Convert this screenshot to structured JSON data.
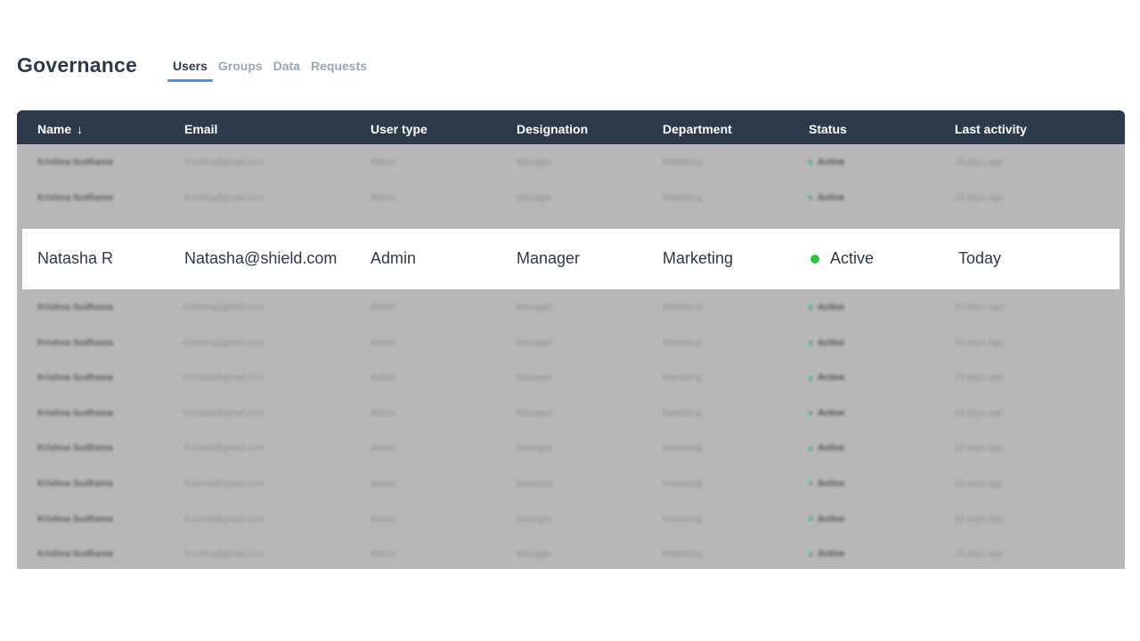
{
  "page": {
    "title": "Governance",
    "tabs": [
      {
        "label": "Users",
        "active": true
      },
      {
        "label": "Groups",
        "active": false
      },
      {
        "label": "Data",
        "active": false
      },
      {
        "label": "Requests",
        "active": false
      }
    ]
  },
  "table": {
    "columns": [
      "Name",
      "Email",
      "User type",
      "Designation",
      "Department",
      "Status",
      "Last activity"
    ],
    "sort_icon": "arrow-down-icon",
    "blurred_row": {
      "name": "Krishna Sudhama",
      "email": "Krishna@gmail.com",
      "user_type": "Admin",
      "designation": "Manager",
      "department": "Marketing",
      "status": "Active",
      "last_activity": "10 days ago"
    },
    "highlighted_row": {
      "name": "Natasha R",
      "email": "Natasha@shield.com",
      "user_type": "Admin",
      "designation": "Manager",
      "department": "Marketing",
      "status": "Active",
      "last_activity": "Today"
    }
  },
  "colors": {
    "header_bg": "#2c3a4b",
    "accent": "#3f96e2",
    "status_active": "#27c73a",
    "overlay": "#b7b7b7"
  }
}
